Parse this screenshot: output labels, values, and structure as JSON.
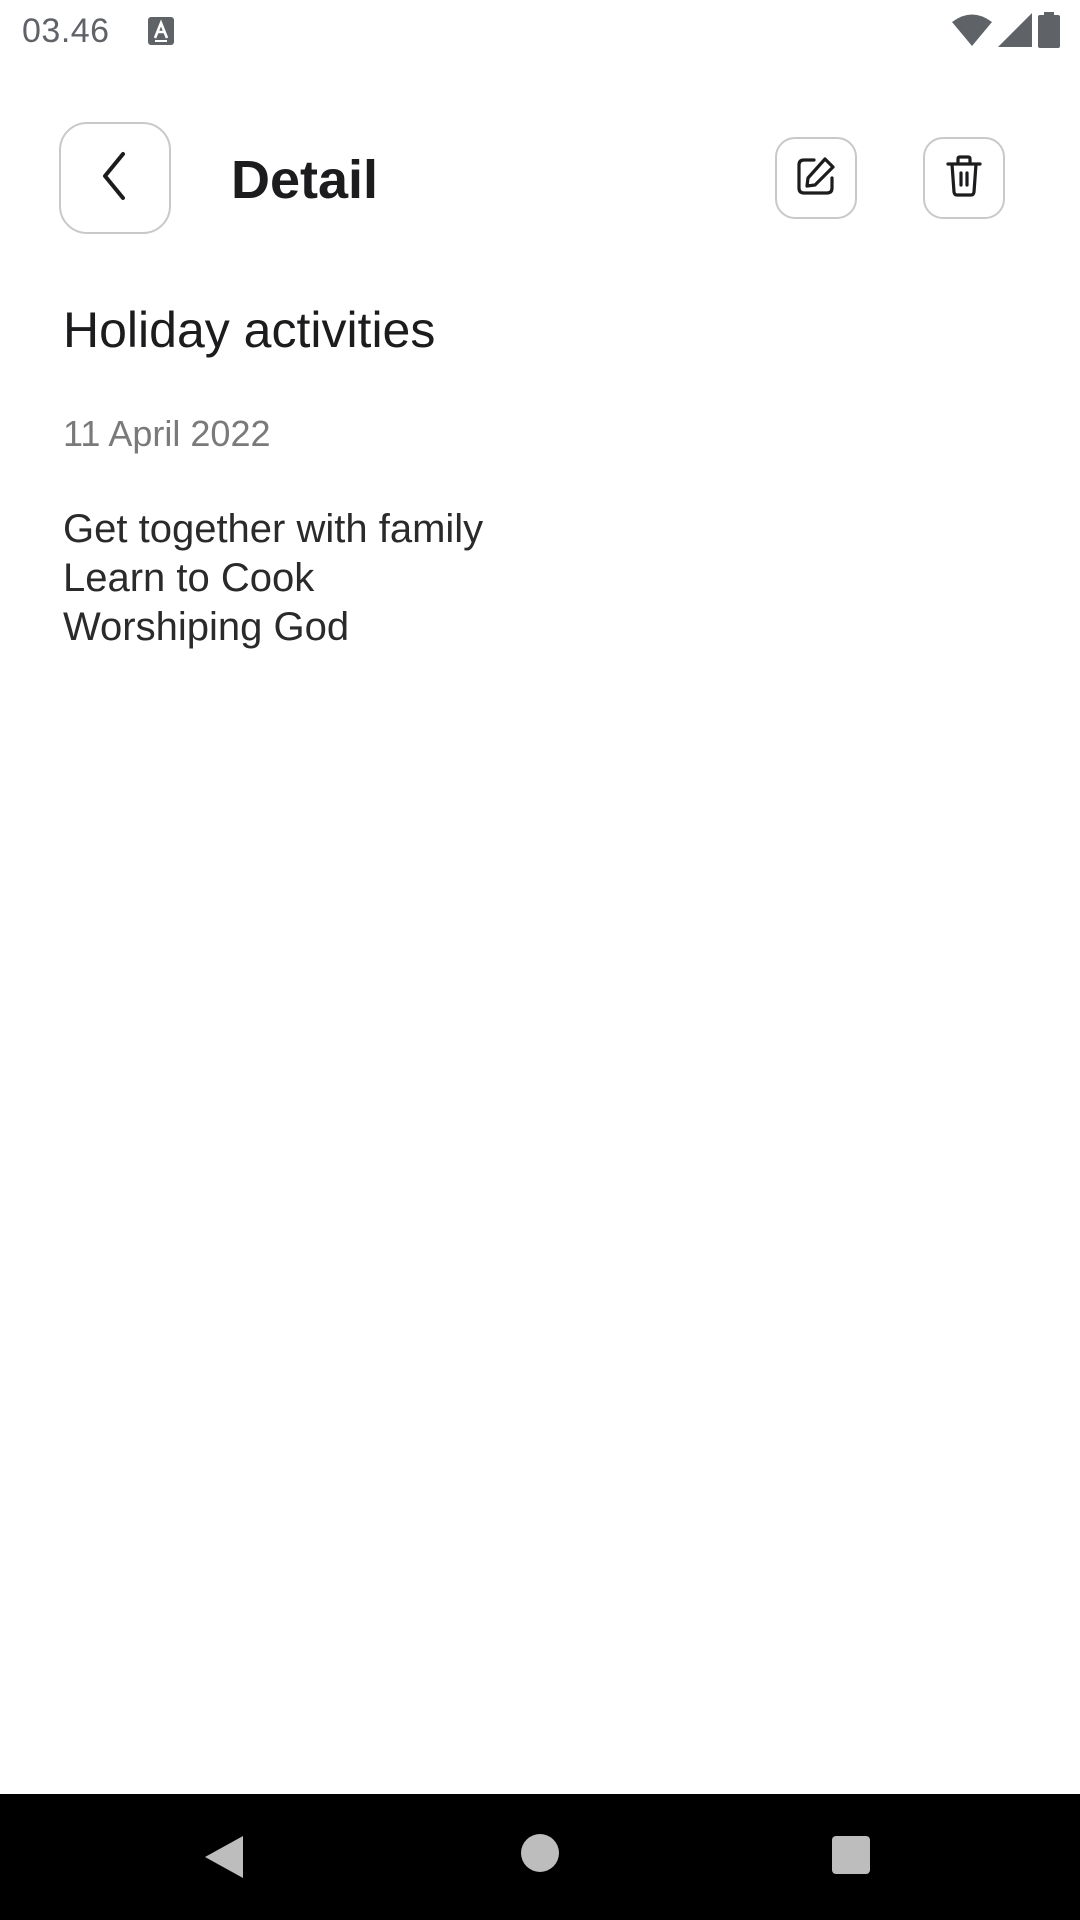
{
  "status_bar": {
    "time": "03.46",
    "icons": [
      "keyboard-a-icon",
      "wifi-icon",
      "signal-icon",
      "battery-icon"
    ]
  },
  "header": {
    "title": "Detail",
    "icons": {
      "back": "chevron-left-icon",
      "edit": "edit-icon",
      "delete": "trash-icon"
    }
  },
  "note": {
    "title": "Holiday activities",
    "date": "11 April 2022",
    "lines": [
      "Get together with family",
      "Learn to Cook",
      "Worshiping God"
    ]
  },
  "nav_bar": {
    "icons": [
      "nav-back-icon",
      "nav-home-icon",
      "nav-recents-icon"
    ]
  },
  "colors": {
    "background": "#ffffff",
    "text_primary": "#1c1c1e",
    "text_secondary": "#7a7a7a",
    "border": "#c9c9c9",
    "nav_bar": "#000000"
  }
}
